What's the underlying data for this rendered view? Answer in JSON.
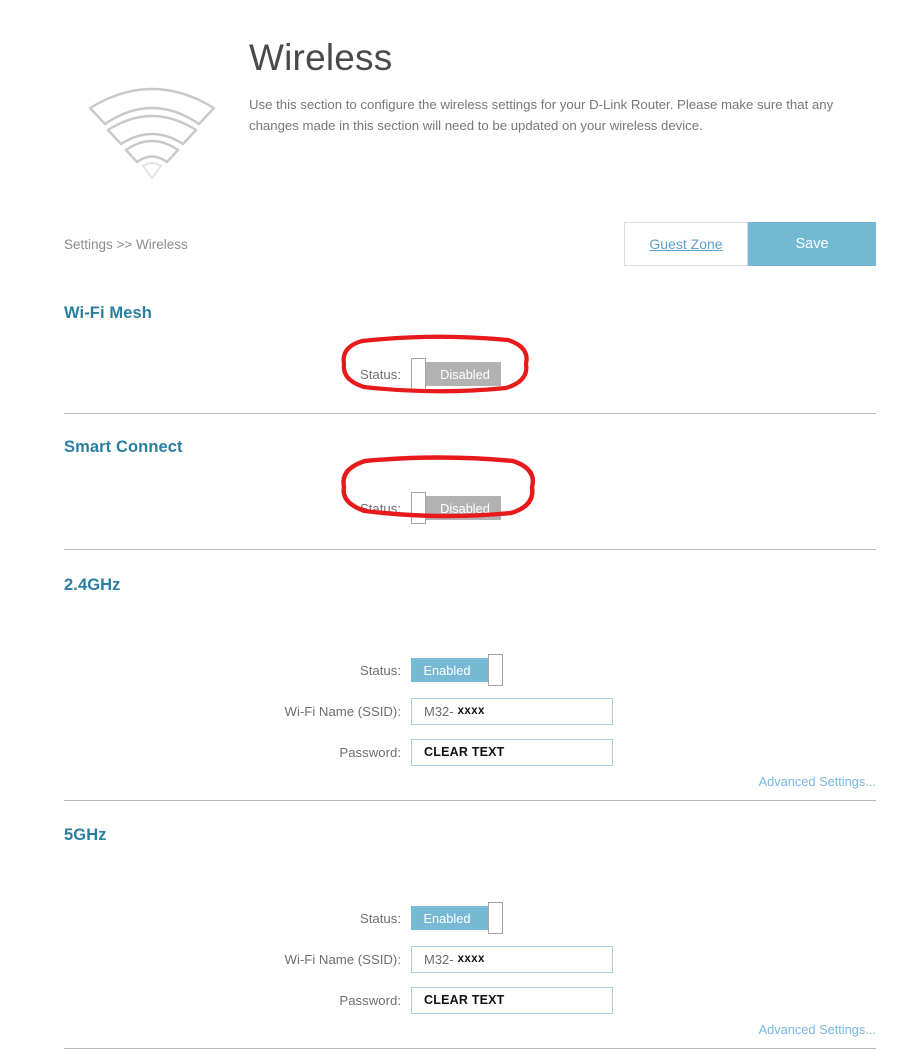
{
  "header": {
    "title": "Wireless",
    "description": "Use this section to configure the wireless settings for your D-Link Router. Please make sure that any changes made in this section will need to be updated on your wireless device.",
    "icon": "wifi-signal-icon"
  },
  "breadcrumb": "Settings >> Wireless",
  "actions": {
    "guest_zone_label": "Guest Zone",
    "save_label": "Save",
    "save_color": "#73b9d4"
  },
  "sections": [
    {
      "id": "wifi-mesh",
      "title": "Wi-Fi Mesh",
      "status_label": "Status:",
      "status_value": "Disabled",
      "status_state": "off",
      "annotated": true
    },
    {
      "id": "smart-connect",
      "title": "Smart Connect",
      "status_label": "Status:",
      "status_value": "Disabled",
      "status_state": "off",
      "annotated": true
    },
    {
      "id": "band-24ghz",
      "title": "2.4GHz",
      "status_label": "Status:",
      "status_value": "Enabled",
      "status_state": "on",
      "annotated": false,
      "ssid_label": "Wi-Fi Name (SSID):",
      "ssid_prefix": "M32-",
      "ssid_redacted": "xxxx",
      "password_label": "Password:",
      "password_value": "CLEAR TEXT",
      "advanced_link": "Advanced Settings..."
    },
    {
      "id": "band-5ghz",
      "title": "5GHz",
      "status_label": "Status:",
      "status_value": "Enabled",
      "status_state": "on",
      "annotated": false,
      "ssid_label": "Wi-Fi Name (SSID):",
      "ssid_prefix": "M32-",
      "ssid_redacted": "xxxx",
      "password_label": "Password:",
      "password_value": "CLEAR TEXT",
      "advanced_link": "Advanced Settings..."
    }
  ],
  "colors": {
    "heading": "#2b7ea1",
    "accent": "#73b9d4",
    "toggle_off": "#b2b2b2",
    "toggle_on": "#76bad6",
    "annotation": "#e8191b"
  }
}
